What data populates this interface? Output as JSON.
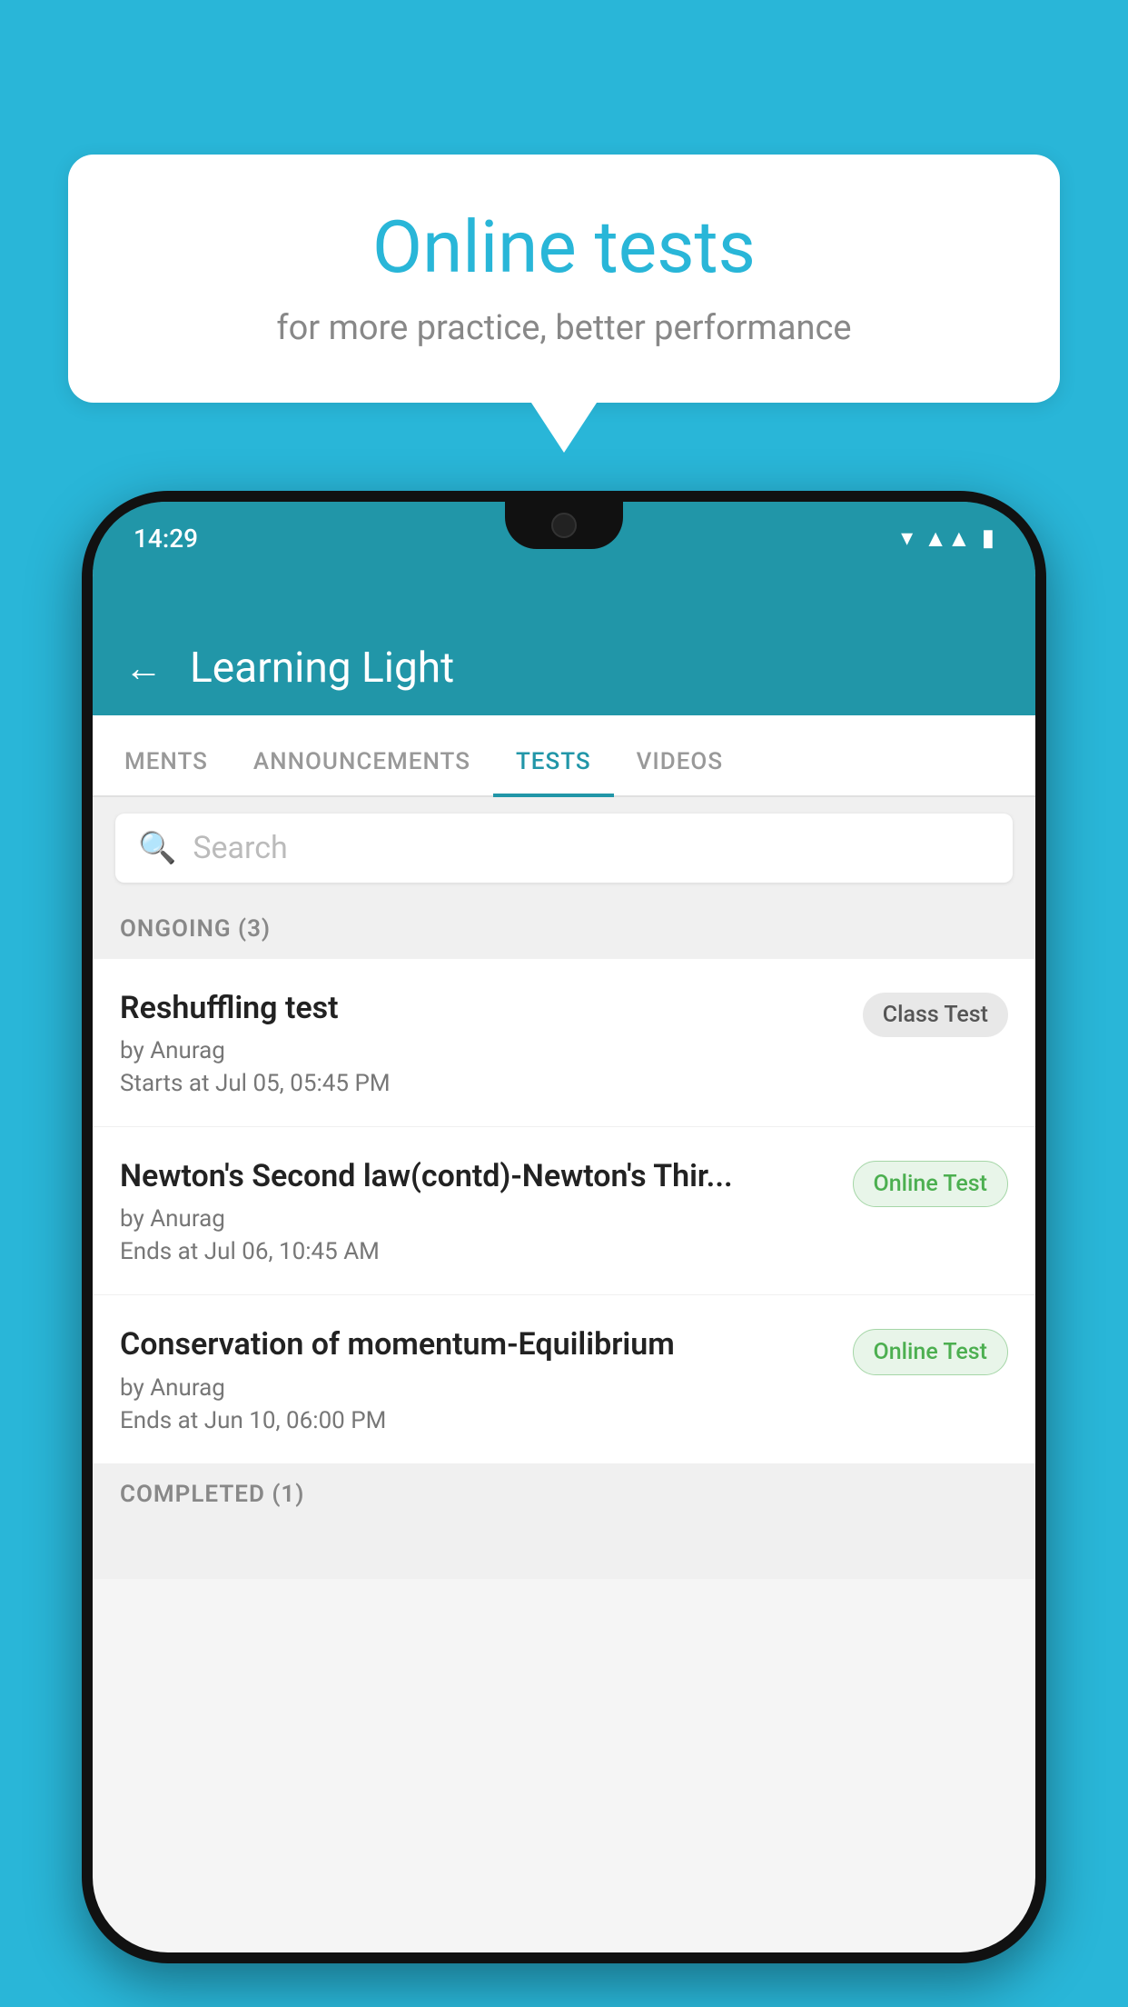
{
  "background": {
    "color": "#29b6d8"
  },
  "speech_bubble": {
    "title": "Online tests",
    "subtitle": "for more practice, better performance"
  },
  "phone": {
    "status_bar": {
      "time": "14:29"
    },
    "app_header": {
      "title": "Learning Light",
      "back_label": "←"
    },
    "tabs": [
      {
        "label": "MENTS",
        "active": false
      },
      {
        "label": "ANNOUNCEMENTS",
        "active": false
      },
      {
        "label": "TESTS",
        "active": true
      },
      {
        "label": "VIDEOS",
        "active": false
      }
    ],
    "search": {
      "placeholder": "Search"
    },
    "ongoing_section": {
      "label": "ONGOING (3)"
    },
    "tests": [
      {
        "name": "Reshuffling test",
        "by": "by Anurag",
        "time": "Starts at  Jul 05, 05:45 PM",
        "badge": "Class Test",
        "badge_type": "class"
      },
      {
        "name": "Newton's Second law(contd)-Newton's Thir...",
        "by": "by Anurag",
        "time": "Ends at  Jul 06, 10:45 AM",
        "badge": "Online Test",
        "badge_type": "online"
      },
      {
        "name": "Conservation of momentum-Equilibrium",
        "by": "by Anurag",
        "time": "Ends at  Jun 10, 06:00 PM",
        "badge": "Online Test",
        "badge_type": "online"
      }
    ],
    "completed_section": {
      "label": "COMPLETED (1)"
    }
  }
}
